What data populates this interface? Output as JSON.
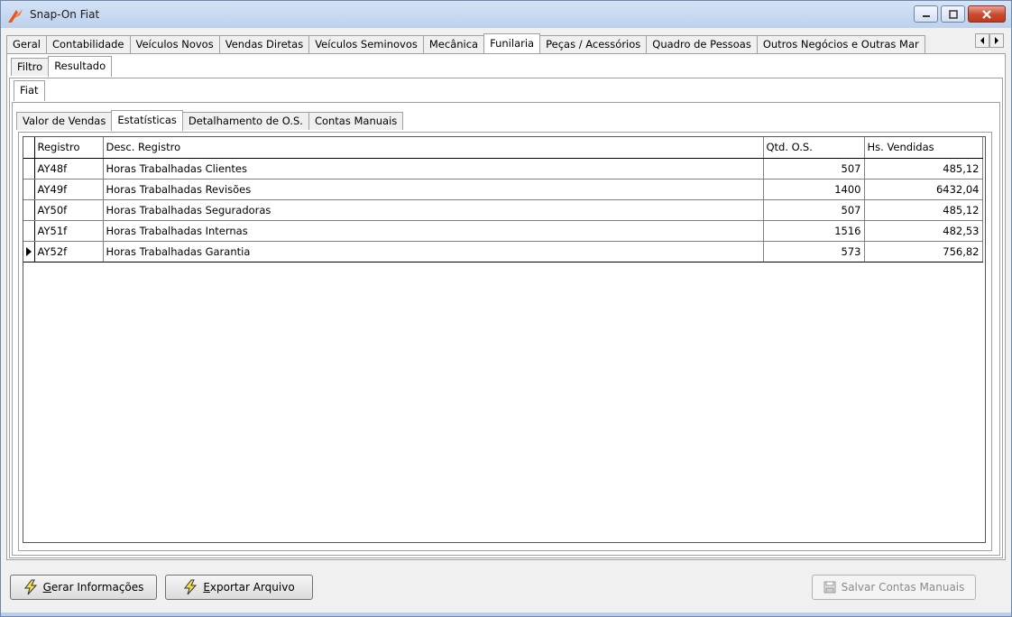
{
  "window": {
    "title": "Snap-On Fiat"
  },
  "main_tabs": [
    "Geral",
    "Contabilidade",
    "Veículos Novos",
    "Vendas Diretas",
    "Veículos Seminovos",
    "Mecânica",
    "Funilaria",
    "Peças / Acessórios",
    "Quadro de Pessoas",
    "Outros Negócios e Outras Mar"
  ],
  "main_tabs_active": 6,
  "sub_tabs": [
    "Filtro",
    "Resultado"
  ],
  "brand_tabs": [
    "Fiat"
  ],
  "report_tabs": [
    "Valor de Vendas",
    "Estatísticas",
    "Detalhamento de O.S.",
    "Contas Manuais"
  ],
  "grid": {
    "columns": [
      "Registro",
      "Desc. Registro",
      "Qtd. O.S.",
      "Hs. Vendidas"
    ],
    "rows": [
      {
        "registro": "AY48f",
        "desc": "Horas Trabalhadas Clientes",
        "qtd": "507",
        "hs": "485,12"
      },
      {
        "registro": "AY49f",
        "desc": "Horas Trabalhadas Revisões",
        "qtd": "1400",
        "hs": "6432,04"
      },
      {
        "registro": "AY50f",
        "desc": "Horas Trabalhadas Seguradoras",
        "qtd": "507",
        "hs": "485,12"
      },
      {
        "registro": "AY51f",
        "desc": "Horas Trabalhadas Internas",
        "qtd": "1516",
        "hs": "482,53"
      },
      {
        "registro": "AY52f",
        "desc": "Horas Trabalhadas Garantia",
        "qtd": "573",
        "hs": "756,82"
      }
    ]
  },
  "buttons": {
    "gerar": {
      "first": "G",
      "rest": "erar Informações"
    },
    "exportar": {
      "first": "E",
      "rest": "xportar Arquivo"
    },
    "salvar": "Salvar Contas Manuais"
  }
}
